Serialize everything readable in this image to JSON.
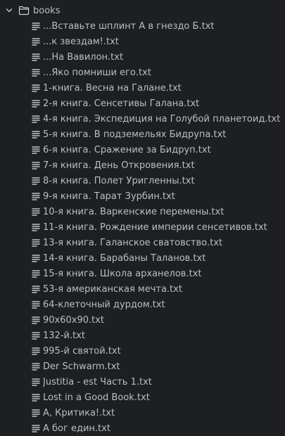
{
  "folder": {
    "name": "books",
    "expanded": true,
    "chevron_icon": "chevron-down-icon",
    "folder_icon": "folder-icon"
  },
  "file_icon": "text-file-icon",
  "files": [
    "...Вставьте шплинт А в гнездо Б.txt",
    "...к звездам!.txt",
    "...На Вавилон.txt",
    "...Яко помниши его.txt",
    "1-книга. Весна на Галане.txt",
    "2-я книга. Сенсетивы Галана.txt",
    "4-я книга. Экспедиция на Голубой планетоид.txt",
    "5-я книга. В подземельях Бидрупа.txt",
    "6-я книга. Сражение за Бидруп.txt",
    "7-я книга. День Откровения.txt",
    "8-я книга. Полет Уригленны.txt",
    "9-я книга. Тарат Зурбин.txt",
    "10-я книга. Варкенские перемены.txt",
    "11-я книга. Рождение империи сенсетивов.txt",
    "13-я книга. Галанское сватовство.txt",
    "14-я книга. Барабаны Таланов.txt",
    "15-я книга. Школа арханелов.txt",
    "53-я американская мечта.txt",
    "64-клеточный дурдом.txt",
    "90х60х90.txt",
    "132-й.txt",
    "995-й святой.txt",
    "Der Schwarm.txt",
    "Justitia - est Часть 1.txt",
    "Lost in a Good Book.txt",
    "А, Критика!.txt",
    "А бог един.txt"
  ],
  "colors": {
    "background": "#1e1f22",
    "text": "#bcbec4",
    "icon": "#ced0d6"
  }
}
